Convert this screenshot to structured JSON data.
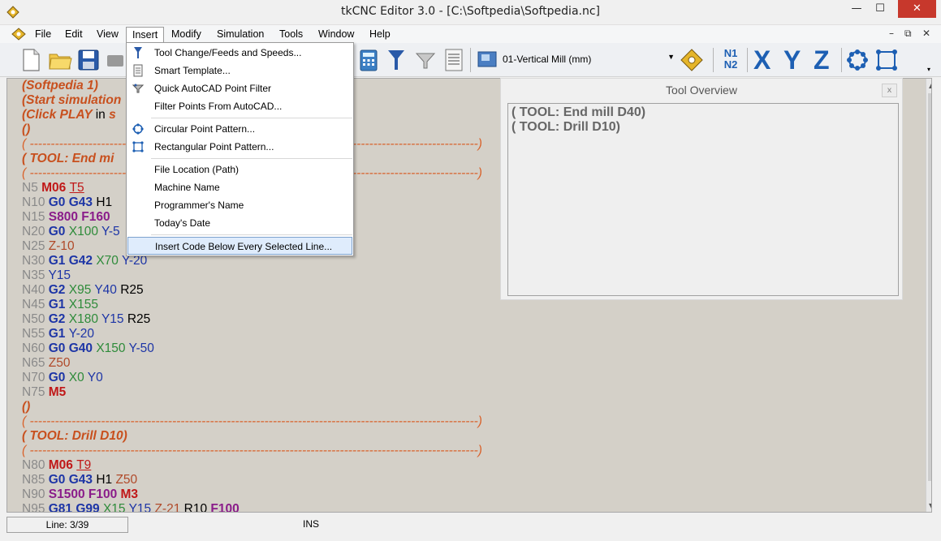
{
  "window": {
    "title": "tkCNC Editor 3.0 - [C:\\Softpedia\\Softpedia.nc]",
    "minimize": "—",
    "maximize": "☐",
    "close": "✕"
  },
  "menubar": {
    "items": [
      "File",
      "Edit",
      "View",
      "Insert",
      "Modify",
      "Simulation",
      "Tools",
      "Window",
      "Help"
    ],
    "open_menu": "Insert",
    "mdi_minimize": "–",
    "mdi_restore": "⧉",
    "mdi_close": "✕"
  },
  "toolbar": {
    "machine_value": "01-Vertical Mill (mm)",
    "n1": "N1",
    "n2": "N2",
    "x": "X",
    "y": "Y",
    "z": "Z"
  },
  "insert_menu": {
    "items": [
      {
        "label": "Tool Change/Feeds and Speeds...",
        "icon": "tool-icon"
      },
      {
        "label": "Smart Template...",
        "icon": "template-icon"
      },
      {
        "label": "Quick AutoCAD Point Filter",
        "icon": "filter-icon"
      },
      {
        "label": "Filter Points From AutoCAD...",
        "icon": ""
      },
      {
        "label": "Circular Point Pattern...",
        "icon": "circular-pattern-icon"
      },
      {
        "label": "Rectangular Point Pattern...",
        "icon": "rectangular-pattern-icon"
      },
      {
        "label": "File Location (Path)",
        "icon": ""
      },
      {
        "label": "Machine Name",
        "icon": ""
      },
      {
        "label": "Programmer's Name",
        "icon": ""
      },
      {
        "label": "Today's Date",
        "icon": ""
      },
      {
        "label": "Insert Code Below Every Selected Line...",
        "icon": ""
      }
    ]
  },
  "tool_overview": {
    "title": "Tool Overview",
    "close": "x",
    "entries": [
      "( TOOL: End mill D40)",
      "( TOOL: Drill D10)"
    ]
  },
  "editor": {
    "lines": [
      [
        {
          "t": "(Softpedia 1)",
          "c": "comment"
        }
      ],
      [
        {
          "t": "(Start simulation",
          "c": "comment"
        }
      ],
      [
        {
          "t": "(Click PLAY ",
          "c": "comment"
        },
        {
          "t": "in",
          "c": "selword"
        },
        {
          "t": " s",
          "c": "comment"
        }
      ],
      [
        {
          "t": "()",
          "c": "comment"
        }
      ],
      [
        {
          "t": "( -----------------------------------------------------------------------------------------------------------)",
          "c": "dashes"
        }
      ],
      [
        {
          "t": "( TOOL: End mi",
          "c": "comment"
        }
      ],
      [
        {
          "t": "( -----------------------------------------------------------------------------------------------------------)",
          "c": "dashes"
        }
      ],
      [
        {
          "t": "N5 ",
          "c": "n"
        },
        {
          "t": "M06 ",
          "c": "m"
        },
        {
          "t": "T5",
          "c": "t"
        }
      ],
      [
        {
          "t": "N10 ",
          "c": "n"
        },
        {
          "t": "G0 G43 ",
          "c": "g"
        },
        {
          "t": "H1",
          "c": "h"
        }
      ],
      [
        {
          "t": "N15 ",
          "c": "n"
        },
        {
          "t": "S800 F160",
          "c": "s"
        }
      ],
      [
        {
          "t": "N20 ",
          "c": "n"
        },
        {
          "t": "G0 ",
          "c": "g"
        },
        {
          "t": "X100 ",
          "c": "x"
        },
        {
          "t": "Y-5",
          "c": "y"
        }
      ],
      [
        {
          "t": "N25 ",
          "c": "n"
        },
        {
          "t": "Z-10",
          "c": "z"
        }
      ],
      [
        {
          "t": "N30 ",
          "c": "n"
        },
        {
          "t": "G1 G42 ",
          "c": "g"
        },
        {
          "t": "X70 ",
          "c": "x"
        },
        {
          "t": "Y-20",
          "c": "y"
        }
      ],
      [
        {
          "t": "N35 ",
          "c": "n"
        },
        {
          "t": "Y15",
          "c": "y"
        }
      ],
      [
        {
          "t": "N40 ",
          "c": "n"
        },
        {
          "t": "G2 ",
          "c": "g"
        },
        {
          "t": "X95 ",
          "c": "x"
        },
        {
          "t": "Y40 ",
          "c": "y"
        },
        {
          "t": "R25",
          "c": "r"
        }
      ],
      [
        {
          "t": "N45 ",
          "c": "n"
        },
        {
          "t": "G1 ",
          "c": "g"
        },
        {
          "t": "X155",
          "c": "x"
        }
      ],
      [
        {
          "t": "N50 ",
          "c": "n"
        },
        {
          "t": "G2 ",
          "c": "g"
        },
        {
          "t": "X180 ",
          "c": "x"
        },
        {
          "t": "Y15 ",
          "c": "y"
        },
        {
          "t": "R25",
          "c": "r"
        }
      ],
      [
        {
          "t": "N55 ",
          "c": "n"
        },
        {
          "t": "G1 ",
          "c": "g"
        },
        {
          "t": "Y-20",
          "c": "y"
        }
      ],
      [
        {
          "t": "N60 ",
          "c": "n"
        },
        {
          "t": "G0 G40 ",
          "c": "g"
        },
        {
          "t": "X150 ",
          "c": "x"
        },
        {
          "t": "Y-50",
          "c": "y"
        }
      ],
      [
        {
          "t": "N65 ",
          "c": "n"
        },
        {
          "t": "Z50",
          "c": "z"
        }
      ],
      [
        {
          "t": "N70 ",
          "c": "n"
        },
        {
          "t": "G0 ",
          "c": "g"
        },
        {
          "t": "X0 ",
          "c": "x"
        },
        {
          "t": "Y0",
          "c": "y"
        }
      ],
      [
        {
          "t": "N75 ",
          "c": "n"
        },
        {
          "t": "M5",
          "c": "m"
        }
      ],
      [
        {
          "t": "()",
          "c": "comment"
        }
      ],
      [
        {
          "t": "( -----------------------------------------------------------------------------------------------------------)",
          "c": "dashes"
        }
      ],
      [
        {
          "t": "( TOOL: Drill D10)",
          "c": "comment"
        }
      ],
      [
        {
          "t": "( -----------------------------------------------------------------------------------------------------------)",
          "c": "dashes"
        }
      ],
      [
        {
          "t": "N80 ",
          "c": "n"
        },
        {
          "t": "M06 ",
          "c": "m"
        },
        {
          "t": "T9",
          "c": "t"
        }
      ],
      [
        {
          "t": "N85 ",
          "c": "n"
        },
        {
          "t": "G0 G43 ",
          "c": "g"
        },
        {
          "t": "H1 ",
          "c": "h"
        },
        {
          "t": "Z50",
          "c": "z"
        }
      ],
      [
        {
          "t": "N90 ",
          "c": "n"
        },
        {
          "t": "S1500 F100 ",
          "c": "s"
        },
        {
          "t": "M3",
          "c": "m"
        }
      ],
      [
        {
          "t": "N95 ",
          "c": "n"
        },
        {
          "t": "G81 G99 ",
          "c": "g"
        },
        {
          "t": "X15 ",
          "c": "x"
        },
        {
          "t": "Y15 ",
          "c": "y"
        },
        {
          "t": "Z-21 ",
          "c": "z"
        },
        {
          "t": "R10 ",
          "c": "r"
        },
        {
          "t": "F100",
          "c": "s"
        }
      ]
    ]
  },
  "statusbar": {
    "line": "Line: 3/39",
    "mode": "INS"
  }
}
